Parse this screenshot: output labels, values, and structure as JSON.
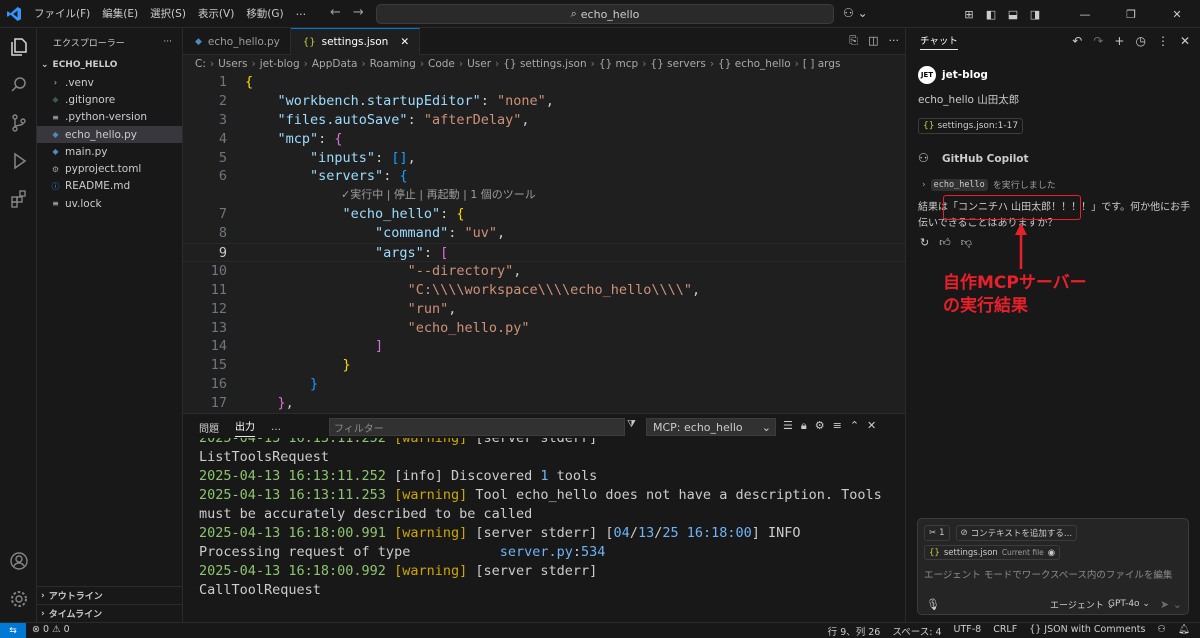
{
  "titlebar": {
    "menu": [
      "ファイル(F)",
      "編集(E)",
      "選択(S)",
      "表示(V)",
      "移動(G)",
      "…"
    ],
    "search": "echo_hello"
  },
  "sidebar": {
    "title": "エクスプローラー",
    "folder": "ECHO_HELLO",
    "items": [
      {
        "label": ".venv",
        "icon": "chevron-right-icon"
      },
      {
        "label": ".gitignore",
        "icon": "git-icon"
      },
      {
        "label": ".python-version",
        "icon": "file-icon"
      },
      {
        "label": "echo_hello.py",
        "icon": "python-icon"
      },
      {
        "label": "main.py",
        "icon": "python-icon"
      },
      {
        "label": "pyproject.toml",
        "icon": "gear-icon"
      },
      {
        "label": "README.md",
        "icon": "info-icon"
      },
      {
        "label": "uv.lock",
        "icon": "file-icon"
      }
    ],
    "outline": "アウトライン",
    "timeline": "タイムライン"
  },
  "tabs": [
    {
      "label": "echo_hello.py",
      "active": false
    },
    {
      "label": "settings.json",
      "active": true
    }
  ],
  "breadcrumb": [
    "C:",
    "Users",
    "jet-blog",
    "AppData",
    "Roaming",
    "Code",
    "User",
    "{} settings.json",
    "{} mcp",
    "{} servers",
    "{} echo_hello",
    "[ ] args"
  ],
  "editor": {
    "current_line": 9,
    "codelens": "✓実行中 | 停止 | 再起動 | 1 個のツール"
  },
  "panel": {
    "tabs": [
      "問題",
      "出力",
      "…"
    ],
    "active_tab": "出力",
    "filter_placeholder": "フィルター",
    "channel": "MCP: echo_hello"
  },
  "chat": {
    "title": "チャット",
    "user_name": "jet-blog",
    "user_message": "echo_hello 山田太郎",
    "reference_chip": "settings.json:1-17",
    "bot_name": "GitHub Copilot",
    "tool_name": "echo_hello",
    "tool_ran": "を実行しました",
    "result_prefix": "結果は",
    "result_highlight": "「コンニチハ 山田太郎！！！！」",
    "result_suffix": "です。何か他にお手伝いできることはありますか？",
    "annotation_line1": "自作MCPサーバー",
    "annotation_line2": "の実行結果",
    "input": {
      "tools_count": "1",
      "add_context": "コンテキストを追加する...",
      "current_file": "settings.json",
      "current_file_label": "Current file",
      "placeholder": "エージェント モードでワークスペース内のファイルを編集",
      "mode": "エージェント",
      "model": "GPT-4o"
    }
  },
  "statusbar": {
    "problems": "⊗ 0 ⚠ 0",
    "position": "行 9、列 26",
    "spaces": "スペース: 4",
    "encoding": "UTF-8",
    "eol": "CRLF",
    "language": "{} JSON with Comments"
  },
  "colors": {
    "accent": "#0078d4",
    "annotation": "#e8202a"
  }
}
